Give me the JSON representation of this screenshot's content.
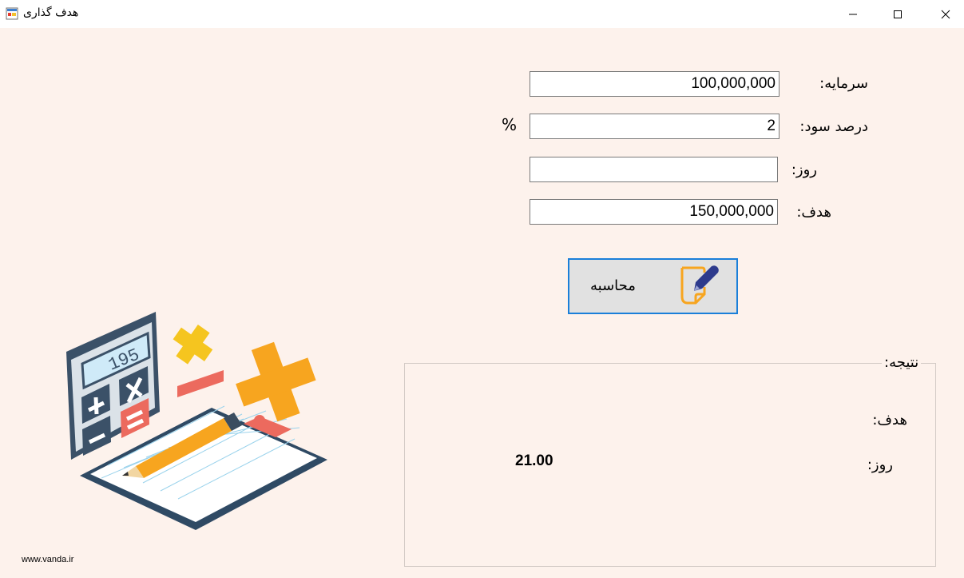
{
  "window": {
    "title": "هدف گذاری",
    "icon": "form-icon",
    "controls": [
      "minimize-icon",
      "maximize-icon",
      "close-icon"
    ]
  },
  "form": {
    "capital": {
      "label": "سرمایه:",
      "value": "100,000,000"
    },
    "profit_percent": {
      "label": "درصد سود:",
      "value": "2",
      "suffix": "%"
    },
    "days": {
      "label": "روز:",
      "value": ""
    },
    "goal": {
      "label": "هدف:",
      "value": "150,000,000"
    }
  },
  "calculate_button": {
    "label": "محاسبه",
    "icon": "edit-note-icon"
  },
  "result": {
    "title": "نتیجه:",
    "goal_label": "هدف:",
    "goal_value": "",
    "days_label": "روز:",
    "days_value": "21.00"
  },
  "footer": {
    "website": "www.vanda.ir"
  },
  "illustration": {
    "icon": "calculator-clipboard-illustration",
    "calculator_display": "195"
  },
  "colors": {
    "background": "#fdf2ec",
    "button_border": "#1a7fd9",
    "button_bg": "#e1e1e1",
    "accent_orange": "#f7a51f"
  }
}
